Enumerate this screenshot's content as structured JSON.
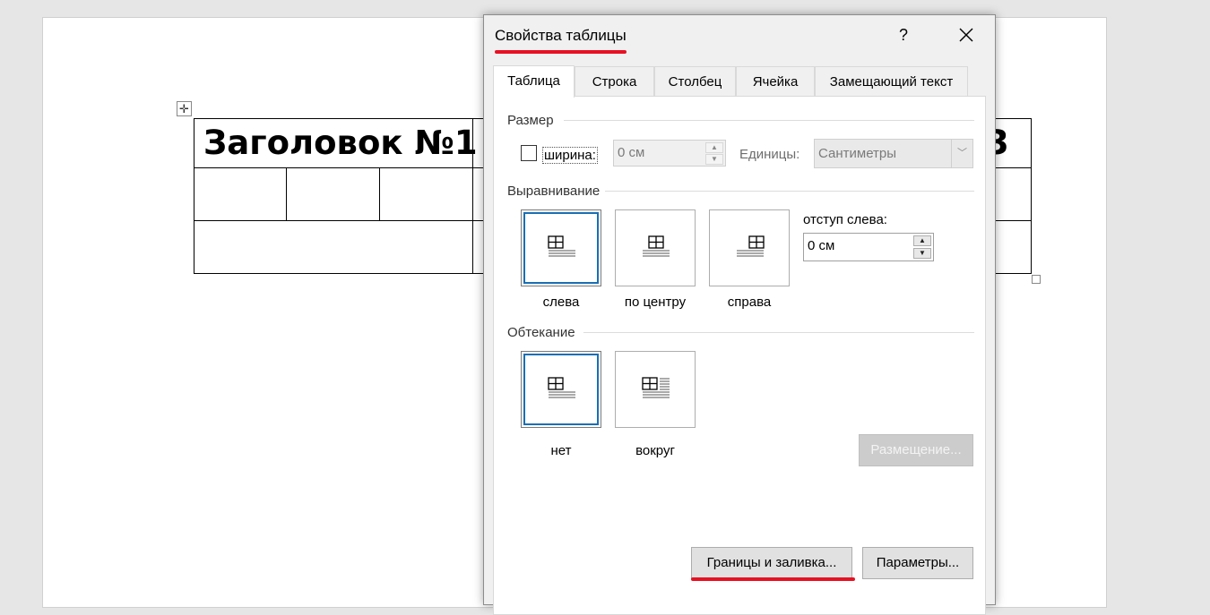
{
  "document": {
    "heading": "Заголовок №1",
    "heading_tail": "3",
    "move_handle_glyph": "✛"
  },
  "dialog": {
    "title": "Свойства таблицы",
    "help_glyph": "?",
    "tabs": [
      {
        "label": "Таблица",
        "active": true
      },
      {
        "label": "Строка",
        "active": false
      },
      {
        "label": "Столбец",
        "active": false
      },
      {
        "label": "Ячейка",
        "active": false
      },
      {
        "label": "Замещающий текст",
        "active": false
      }
    ],
    "size": {
      "section": "Размер",
      "width_label": "ширина:",
      "width_checked": false,
      "width_value": "0 см",
      "units_label": "Единицы:",
      "units_value": "Сантиметры"
    },
    "alignment": {
      "section": "Выравнивание",
      "options": [
        {
          "label": "слева",
          "selected": true
        },
        {
          "label": "по центру",
          "selected": false
        },
        {
          "label": "справа",
          "selected": false
        }
      ],
      "indent_label": "отступ слева:",
      "indent_value": "0 см"
    },
    "wrapping": {
      "section": "Обтекание",
      "options": [
        {
          "label": "нет",
          "selected": true
        },
        {
          "label": "вокруг",
          "selected": false
        }
      ],
      "positioning_button": "Размещение..."
    },
    "buttons": {
      "borders": "Границы и заливка...",
      "options": "Параметры..."
    },
    "colors": {
      "accent": "#1a6fb4",
      "annotation": "#e81123"
    }
  }
}
